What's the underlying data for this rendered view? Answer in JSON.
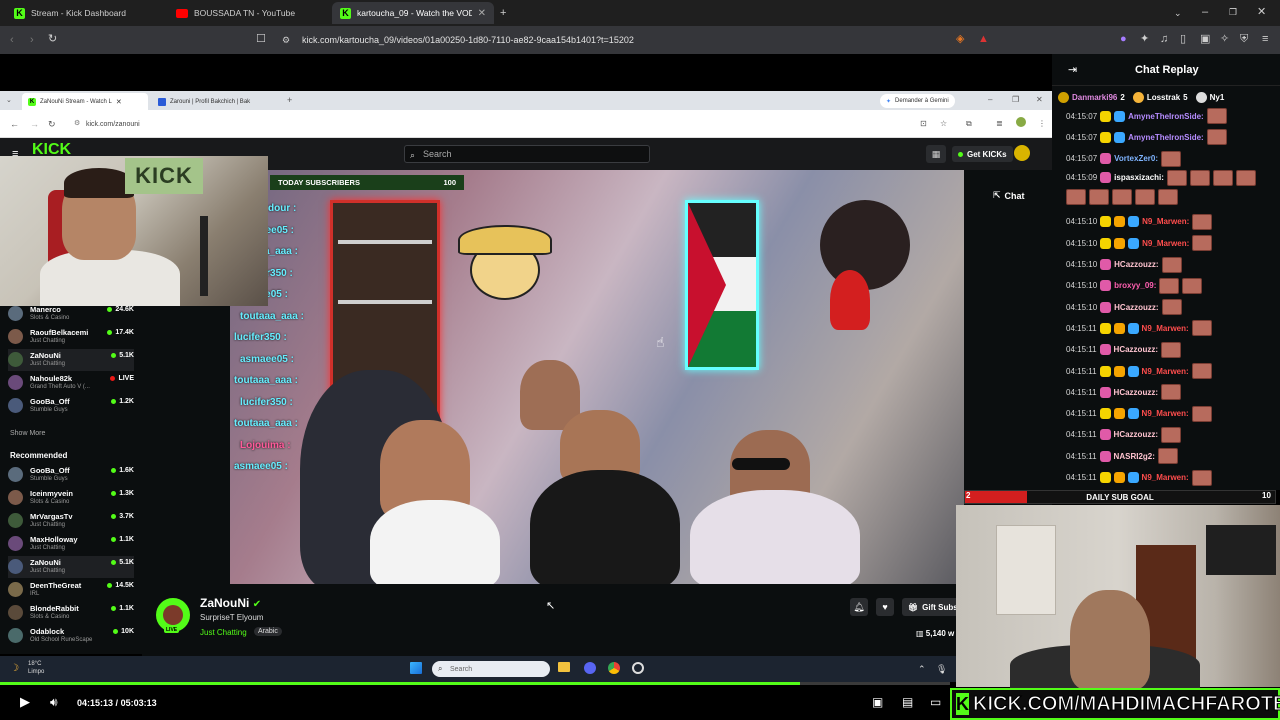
{
  "browser": {
    "tabs": [
      {
        "label": "Stream - Kick Dashboard"
      },
      {
        "label": "BOUSSADA TN - YouTube"
      },
      {
        "label": "kartoucha_09 - Watch the VOD o"
      }
    ],
    "url": "kick.com/kartoucha_09/videos/01a00250-1d80-7110-ae82-9caa154b1401?t=15202"
  },
  "inner_browser": {
    "tabs": [
      {
        "label": "ZaNouNi Stream - Watch L"
      },
      {
        "label": "Zarouni | Profil Bakchich | Bak"
      }
    ],
    "gemini_label": "Demander à Gemini",
    "url": "kick.com/zanouni"
  },
  "kick": {
    "search_placeholder": "Search",
    "get_kicks": "Get KICKs",
    "sidebar_following": [
      {
        "name": "Manerco",
        "sub": "Slots & Casino",
        "viewers": "24.6K"
      },
      {
        "name": "RaoufBelkacemi",
        "sub": "Just Chatting",
        "viewers": "17.4K"
      },
      {
        "name": "ZaNouNi",
        "sub": "Just Chatting",
        "viewers": "5.1K"
      },
      {
        "name": "Nahoule82k",
        "sub": "Grand Theft Auto V (...",
        "viewers": "LIVE"
      },
      {
        "name": "GooBa_Off",
        "sub": "Stumble Guys",
        "viewers": "1.2K"
      }
    ],
    "show_more": "Show More",
    "recommended_label": "Recommended",
    "sidebar_recommended": [
      {
        "name": "GooBa_Off",
        "sub": "Stumble Guys",
        "viewers": "1.6K"
      },
      {
        "name": "Iceinmyvein",
        "sub": "Slots & Casino",
        "viewers": "1.3K"
      },
      {
        "name": "MrVargasTv",
        "sub": "Just Chatting",
        "viewers": "3.7K"
      },
      {
        "name": "MaxHolloway",
        "sub": "Just Chatting",
        "viewers": "1.1K"
      },
      {
        "name": "ZaNouNi",
        "sub": "Just Chatting",
        "viewers": "5.1K"
      },
      {
        "name": "DeenTheGreat",
        "sub": "IRL",
        "viewers": "14.5K"
      },
      {
        "name": "BlondeRabbit",
        "sub": "Slots & Casino",
        "viewers": "1.1K"
      },
      {
        "name": "Odablock",
        "sub": "Old School RuneScape",
        "viewers": "10K"
      }
    ],
    "today_subscribers_label": "TODAY SUBSCRIBERS",
    "today_subscribers_count": "100",
    "overlay_names": [
      "dour :",
      "asmaee05 :",
      "toutaaa_aaa :",
      "lucifer350 :",
      "asmaee05 :",
      "toutaaa_aaa :",
      "lucifer350 :",
      "asmaee05 :",
      "toutaaa_aaa :",
      "lucifer350 :",
      "toutaaa_aaa :",
      "Lojouima :",
      "asmaee05 :"
    ],
    "chat_button": "Chat",
    "streamer": {
      "name": "ZaNouNi",
      "title": "SurpriseT Elyoum",
      "category": "Just Chatting",
      "tag": "Arabic",
      "viewers": "5,140 w",
      "gift_subs": "Gift Subs",
      "live_badge": "LIVE"
    }
  },
  "taskbar": {
    "search_placeholder": "Search",
    "weather_temp": "18°C",
    "weather_desc": "Limpo"
  },
  "player": {
    "current_time": "04:15:13",
    "separator": "/",
    "duration": "05:03:13",
    "progress": 0.842
  },
  "sub_goal": {
    "label": "DAILY SUB GOAL",
    "current": "2",
    "target": "10",
    "progress": 0.2
  },
  "cam_overlay_url": "KICK.COM/MAHDIMACHFAROTB",
  "chat": {
    "title": "Chat Replay",
    "pinned": [
      {
        "name": "Danmarki96",
        "count": "2",
        "color": "#e08ae0"
      },
      {
        "name": "Losstrak",
        "count": "5",
        "color": "#ffffff"
      },
      {
        "name": "Ny1",
        "count": "",
        "color": "#ffffff"
      }
    ],
    "messages": [
      {
        "time": "04:15:07",
        "user": "AmyneTheIronSide:",
        "color": "#b68cff",
        "emotes": 1
      },
      {
        "time": "04:15:07",
        "user": "AmyneTheIronSide:",
        "color": "#b68cff",
        "emotes": 1
      },
      {
        "time": "04:15:07",
        "user": "VortexZer0:",
        "color": "#7fb4ff",
        "emotes": 1
      },
      {
        "time": "04:15:09",
        "user": "ispasxizachi:",
        "color": "#ffffff",
        "emotes": 4
      },
      {
        "time": "04:15:10",
        "user": "N9_Marwen:",
        "color": "#ff4d4d",
        "emotes": 1
      },
      {
        "time": "04:15:10",
        "user": "N9_Marwen:",
        "color": "#ff4d4d",
        "emotes": 1
      },
      {
        "time": "04:15:10",
        "user": "HCazzouzz:",
        "color": "#ffc4d0",
        "emotes": 1
      },
      {
        "time": "04:15:10",
        "user": "broxyy_09:",
        "color": "#ff5fb0",
        "emotes": 2
      },
      {
        "time": "04:15:10",
        "user": "HCazzouzz:",
        "color": "#ffc4d0",
        "emotes": 1
      },
      {
        "time": "04:15:11",
        "user": "N9_Marwen:",
        "color": "#ff4d4d",
        "emotes": 1
      },
      {
        "time": "04:15:11",
        "user": "HCazzouzz:",
        "color": "#ffc4d0",
        "emotes": 1
      },
      {
        "time": "04:15:11",
        "user": "N9_Marwen:",
        "color": "#ff4d4d",
        "emotes": 1
      },
      {
        "time": "04:15:11",
        "user": "HCazzouzz:",
        "color": "#ffc4d0",
        "emotes": 1
      },
      {
        "time": "04:15:11",
        "user": "N9_Marwen:",
        "color": "#ff4d4d",
        "emotes": 1
      },
      {
        "time": "04:15:11",
        "user": "HCazzouzz:",
        "color": "#ffc4d0",
        "emotes": 1
      },
      {
        "time": "04:15:11",
        "user": "NASRI2g2:",
        "color": "#ffc4d0",
        "emotes": 1
      },
      {
        "time": "04:15:11",
        "user": "N9_Marwen:",
        "color": "#ff4d4d",
        "emotes": 1
      }
    ]
  },
  "colors": {
    "kick_green": "#53fc18",
    "accent_red": "#d31f1f"
  }
}
